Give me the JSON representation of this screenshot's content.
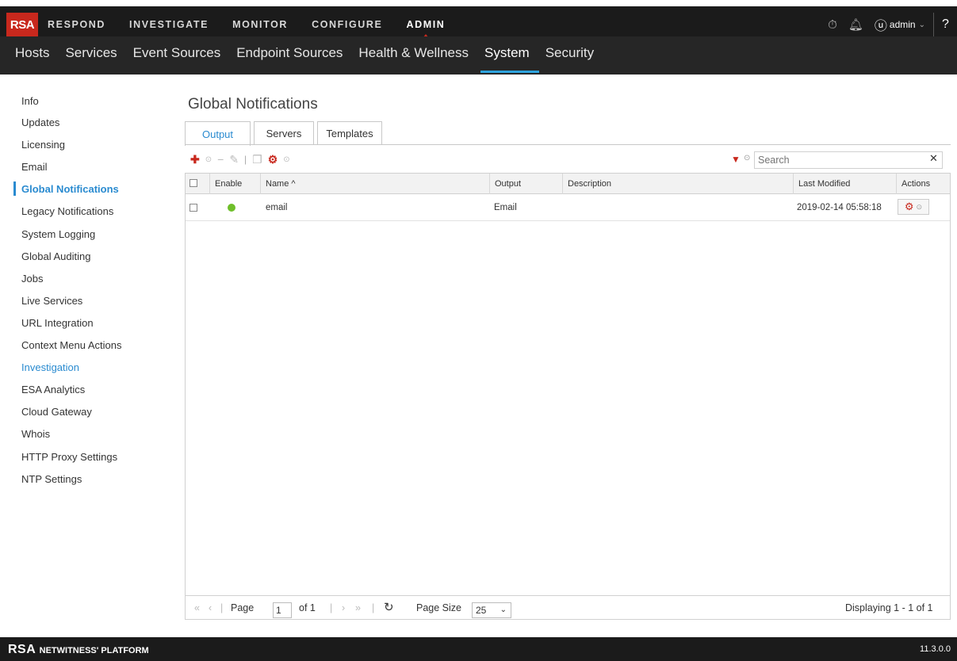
{
  "brand": {
    "logo": "RSA"
  },
  "top_nav": {
    "items": [
      "RESPOND",
      "INVESTIGATE",
      "MONITOR",
      "CONFIGURE",
      "ADMIN"
    ],
    "active": "ADMIN",
    "user": "admin",
    "icons": [
      "stopwatch-icon",
      "bell-icon",
      "user-icon",
      "help-icon"
    ]
  },
  "sub_nav": {
    "items": [
      "Hosts",
      "Services",
      "Event Sources",
      "Endpoint Sources",
      "Health & Wellness",
      "System",
      "Security"
    ],
    "active": "System"
  },
  "sidebar": {
    "items": [
      "Info",
      "Updates",
      "Licensing",
      "Email",
      "Global Notifications",
      "Legacy Notifications",
      "System Logging",
      "Global Auditing",
      "Jobs",
      "Live Services",
      "URL Integration",
      "Context Menu Actions",
      "Investigation",
      "ESA Analytics",
      "Cloud Gateway",
      "Whois",
      "HTTP Proxy Settings",
      "NTP Settings"
    ],
    "active": "Global Notifications"
  },
  "main": {
    "title": "Global Notifications",
    "tabs": [
      "Output",
      "Servers",
      "Templates"
    ],
    "active_tab": "Output",
    "search_placeholder": "Search",
    "columns": [
      "Enable",
      "Name ^",
      "Output",
      "Description",
      "Last Modified",
      "Actions"
    ],
    "rows": [
      {
        "enabled": true,
        "name": "email",
        "output": "Email",
        "description": "",
        "last_modified": "2019-02-14 05:58:18"
      }
    ]
  },
  "pager": {
    "page_label": "Page",
    "page": "1",
    "of": "of 1",
    "page_size_label": "Page Size",
    "page_size": "25",
    "displaying": "Displaying 1 - 1 of 1"
  },
  "footer": {
    "product": "NETWITNESS' PLATFORM",
    "version": "11.3.0.0"
  },
  "colors": {
    "accent": "#2a8bd0",
    "brand_red": "#c8281d",
    "enabled_green": "#6fbf2a"
  }
}
